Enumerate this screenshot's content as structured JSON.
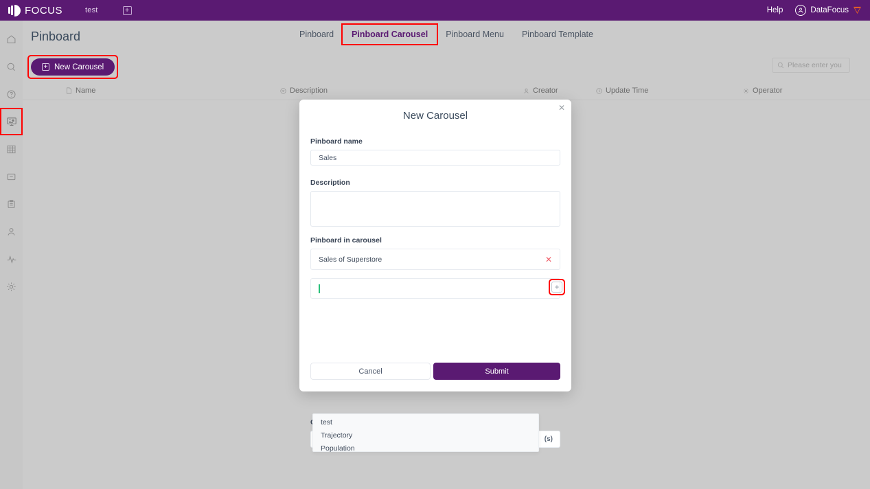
{
  "header": {
    "logo_text": "FOCUS",
    "tab_label": "test",
    "add_tab_icon": "plus-square-icon",
    "help_label": "Help",
    "user_name": "DataFocus",
    "user_avatar_icon": "user-circle-icon",
    "brand_icon": "shield-drop-icon",
    "background_color": "#5a1a72"
  },
  "sidebar": {
    "items": [
      {
        "name": "home",
        "icon": "home-icon",
        "active": false
      },
      {
        "name": "search",
        "icon": "search-icon",
        "active": false
      },
      {
        "name": "help",
        "icon": "question-circle-icon",
        "active": false
      },
      {
        "name": "pinboard",
        "icon": "monitor-icon",
        "active": true
      },
      {
        "name": "table",
        "icon": "grid-table-icon",
        "active": false
      },
      {
        "name": "folder",
        "icon": "folder-minus-icon",
        "active": false
      },
      {
        "name": "clipboard",
        "icon": "clipboard-icon",
        "active": false
      },
      {
        "name": "user",
        "icon": "user-icon",
        "active": false
      },
      {
        "name": "activity",
        "icon": "activity-pulse-icon",
        "active": false
      },
      {
        "name": "settings",
        "icon": "gear-icon",
        "active": false
      }
    ],
    "highlight_color": "#ff0000"
  },
  "page": {
    "title": "Pinboard",
    "tabs": [
      {
        "label": "Pinboard",
        "active": false,
        "highlighted": false
      },
      {
        "label": "Pinboard Carousel",
        "active": true,
        "highlighted": true
      },
      {
        "label": "Pinboard Menu",
        "active": false,
        "highlighted": false
      },
      {
        "label": "Pinboard Template",
        "active": false,
        "highlighted": false
      }
    ]
  },
  "toolbar": {
    "new_carousel_label": "New Carousel",
    "new_carousel_icon": "plus-square-icon",
    "new_carousel_highlighted": true,
    "search_icon": "search-icon",
    "search_placeholder": "Please enter you",
    "search_value": ""
  },
  "table": {
    "columns": [
      {
        "label": "Name",
        "icon": "file-icon"
      },
      {
        "label": "Description",
        "icon": "comment-icon"
      },
      {
        "label": "Creator",
        "icon": "user-icon"
      },
      {
        "label": "Update Time",
        "icon": "clock-icon"
      },
      {
        "label": "Operator",
        "icon": "gear-icon"
      }
    ],
    "rows": []
  },
  "modal": {
    "title": "New Carousel",
    "close_icon": "close-icon",
    "pinboard_name_label": "Pinboard name",
    "pinboard_name_value": "Sales",
    "description_label": "Description",
    "description_value": "",
    "pinboard_in_carousel_label": "Pinboard in carousel",
    "selected_pinboards": [
      {
        "label": "Sales of Superstore",
        "remove_icon": "close-icon"
      }
    ],
    "combo_value": "",
    "add_button_icon": "plus-square-icon",
    "add_button_highlighted": true,
    "suggestions": [
      {
        "label": "test"
      },
      {
        "label": "Trajectory"
      },
      {
        "label": "Population"
      }
    ],
    "interval_label": "C",
    "interval_value": "",
    "interval_unit": "(s)",
    "cancel_label": "Cancel",
    "submit_label": "Submit",
    "submit_color": "#5a1a72"
  }
}
